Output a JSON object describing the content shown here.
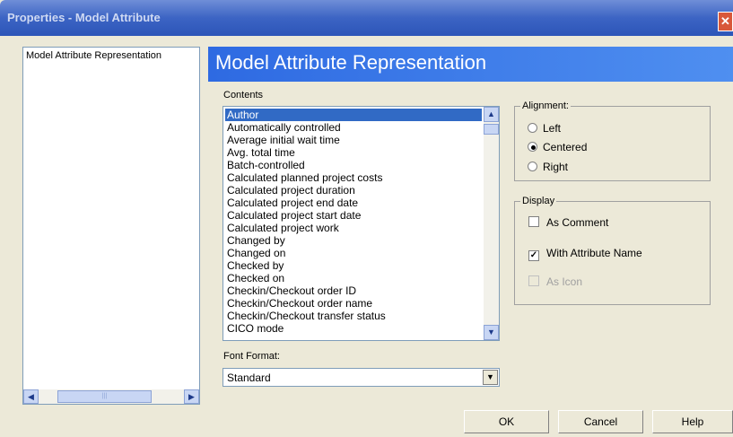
{
  "window": {
    "title": "Properties - Model Attribute",
    "close_glyph": "✕"
  },
  "nav": {
    "items": [
      "Model Attribute Representation"
    ],
    "scroll_left": "◀",
    "scroll_right": "▶",
    "thumb_grip": "|||"
  },
  "main": {
    "title": "Model Attribute Representation",
    "contents_label": "Contents",
    "contents_items": [
      "Author",
      "Automatically controlled",
      "Average initial wait time",
      "Avg. total time",
      "Batch-controlled",
      "Calculated planned project costs",
      "Calculated project duration",
      "Calculated project end date",
      "Calculated project start date",
      "Calculated project work",
      "Changed by",
      "Changed on",
      "Checked by",
      "Checked on",
      "Checkin/Checkout order ID",
      "Checkin/Checkout order name",
      "Checkin/Checkout transfer status",
      "CICO mode"
    ],
    "selected_item": "Author",
    "scroll_up": "▲",
    "scroll_down": "▼",
    "font_format_label": "Font Format:",
    "font_format_value": "Standard",
    "dropdown_arrow": "▼"
  },
  "alignment": {
    "legend": "Alignment:",
    "options": [
      "Left",
      "Centered",
      "Right"
    ],
    "selected": "Centered"
  },
  "display": {
    "legend": "Display",
    "as_comment": {
      "label": "As Comment",
      "checked": false
    },
    "with_attribute_name": {
      "label": "With Attribute Name",
      "checked": true
    },
    "as_icon": {
      "label": "As Icon",
      "checked": false,
      "disabled": true
    },
    "check_glyph": "✓"
  },
  "buttons": {
    "ok": "OK",
    "cancel": "Cancel",
    "help": "Help"
  },
  "colors": {
    "header_blue": "#2e6ae2",
    "selection": "#316ac5",
    "dialog_bg": "#ece9d8"
  }
}
